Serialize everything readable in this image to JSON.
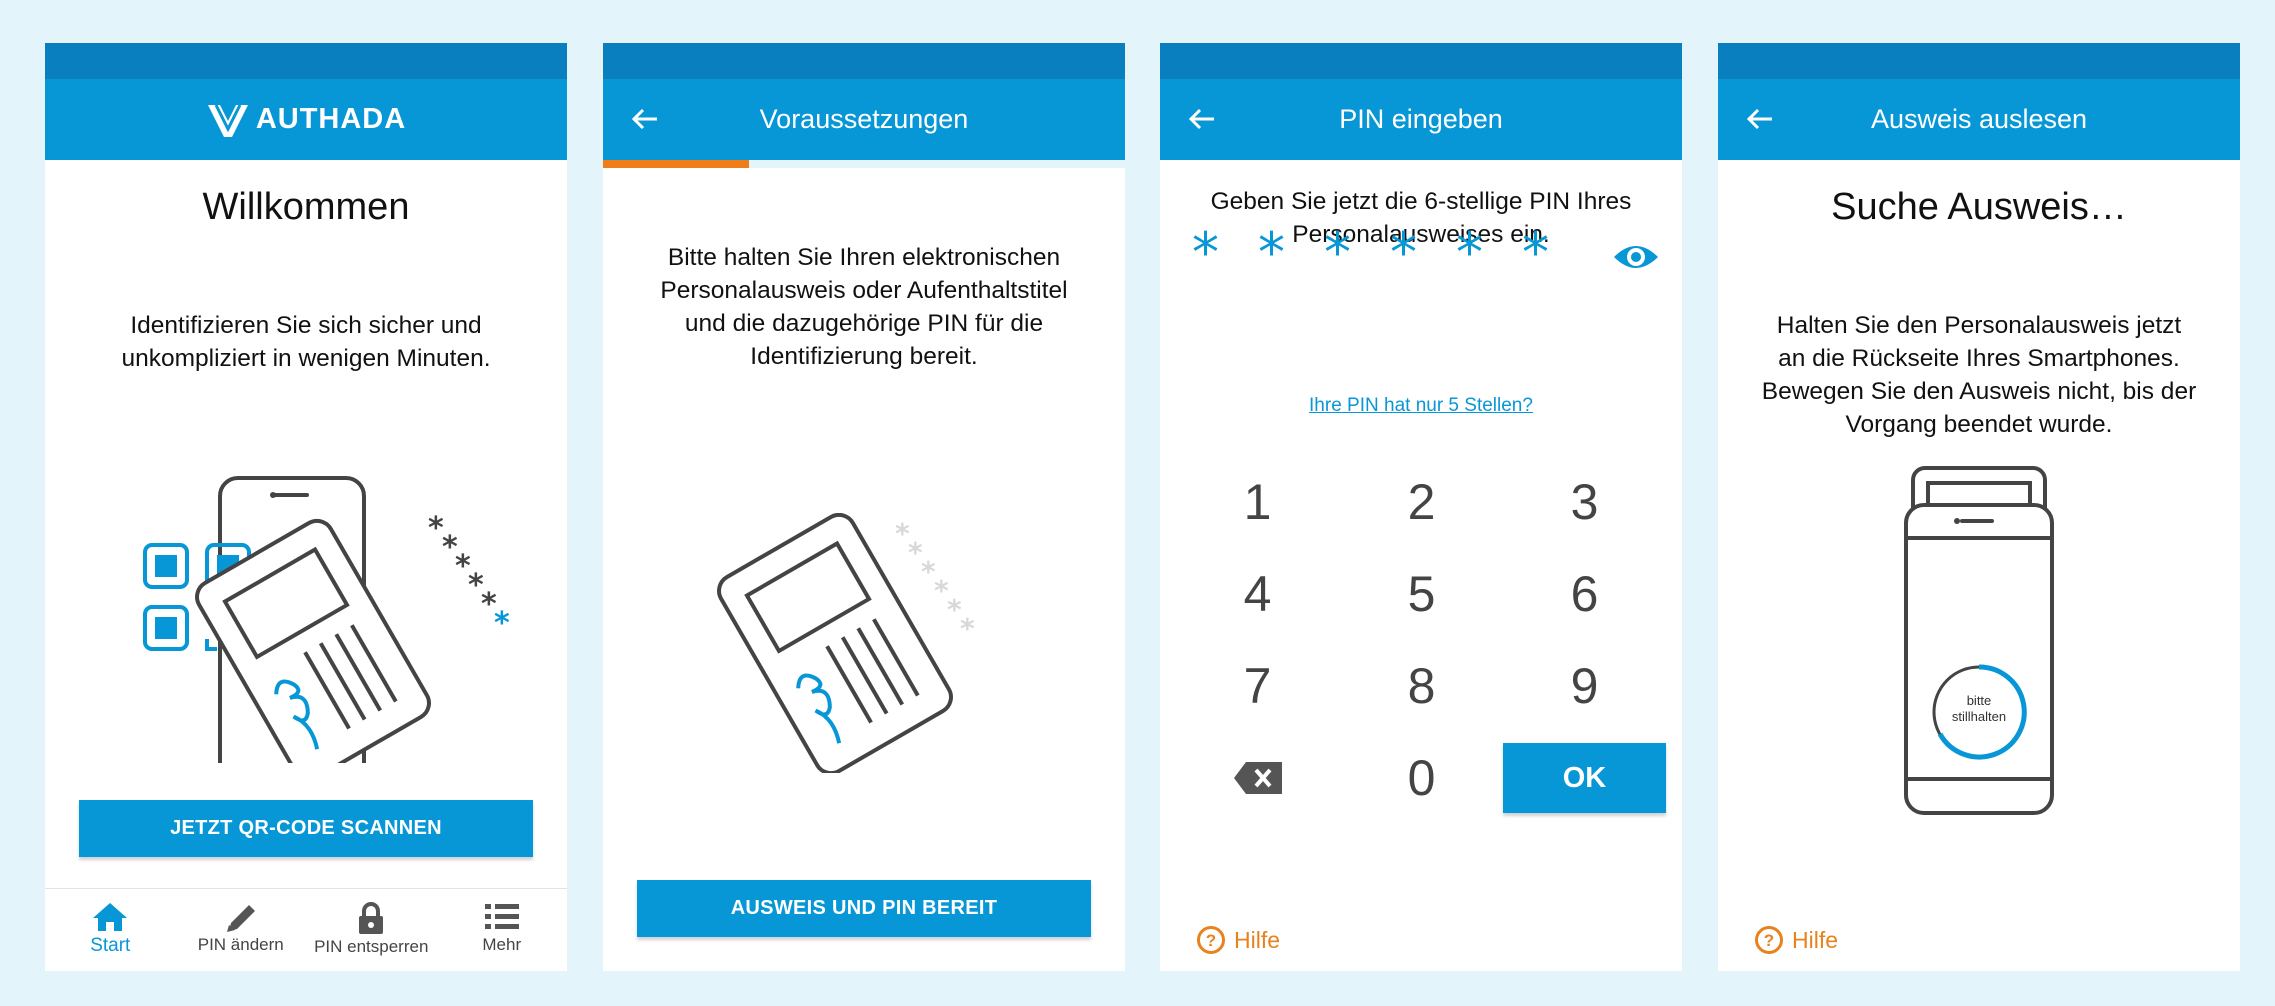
{
  "colors": {
    "background": "#e3f5fb",
    "statusbar": "#0a7fbf",
    "primary": "#0897d6",
    "accent_orange": "#ef7d1a",
    "help_orange": "#e8821c",
    "illustration": "#444444"
  },
  "screen1": {
    "brand": "AUTHADA",
    "title": "Willkommen",
    "description_line1": "Identifizieren Sie sich sicher und",
    "description_line2": "unkompliziert in wenigen Minuten.",
    "scan_button": "JETZT QR-CODE SCANNEN",
    "nav": [
      {
        "label": "Start",
        "icon": "home-icon",
        "active": true
      },
      {
        "label": "PIN ändern",
        "icon": "pencil-icon",
        "active": false
      },
      {
        "label": "PIN entsperren",
        "icon": "lock-icon",
        "active": false
      },
      {
        "label": "Mehr",
        "icon": "list-icon",
        "active": false
      }
    ]
  },
  "screen2": {
    "title": "Voraussetzungen",
    "progress": 0.28,
    "line1": "Bitte halten Sie Ihren elektronischen",
    "line2": "Personalausweis oder Aufenthaltstitel",
    "line3": "und die dazugehörige PIN für die",
    "line4": "Identifizierung bereit.",
    "ready_button": "AUSWEIS UND PIN BEREIT"
  },
  "screen3": {
    "title": "PIN eingeben",
    "line1": "Geben Sie jetzt die 6-stellige PIN Ihres",
    "line2": "Personalausweises ein.",
    "pin_mask": [
      "*",
      "*",
      "*",
      "*",
      "*",
      "*"
    ],
    "five_digit_link": "Ihre PIN hat nur 5 Stellen?",
    "keys": [
      "1",
      "2",
      "3",
      "4",
      "5",
      "6",
      "7",
      "8",
      "9"
    ],
    "zero_key": "0",
    "ok_key": "OK",
    "help": "Hilfe"
  },
  "screen4": {
    "title": "Ausweis auslesen",
    "heading": "Suche Ausweis…",
    "line1": "Halten Sie den Personalausweis jetzt",
    "line2": "an die Rückseite Ihres Smartphones.",
    "line3": "Bewegen Sie den Ausweis nicht, bis der",
    "line4": "Vorgang beendet wurde.",
    "spinner_line1": "bitte",
    "spinner_line2": "stillhalten",
    "help": "Hilfe"
  }
}
